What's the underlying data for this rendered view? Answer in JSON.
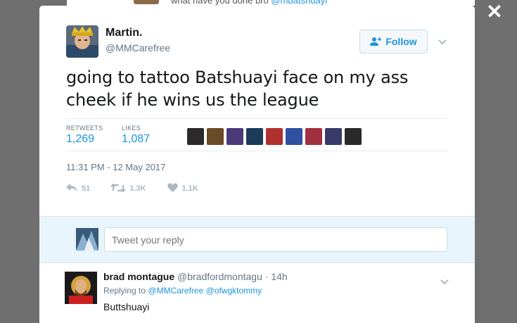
{
  "backdrop": {
    "text_prefix": "what have you done bro",
    "mention": "@mbatshuayi"
  },
  "close_label": "✕",
  "tweet": {
    "author_name": "Martin.",
    "author_handle": "@MMCarefree",
    "follow_label": "Follow",
    "text": "going to tattoo Batshuayi face on my ass cheek if he wins us the league",
    "retweets_label": "RETWEETS",
    "retweets_count": "1,269",
    "likes_label": "LIKES",
    "likes_count": "1,087",
    "timestamp": "11:31 PM - 12 May 2017",
    "actions": {
      "reply_count": "51",
      "retweet_count": "1.3K",
      "like_count": "1.1K"
    },
    "liker_colors": [
      "#2b2b2b",
      "#6b4a2a",
      "#4a3a7a",
      "#1e3a5a",
      "#b03030",
      "#3050a0",
      "#a03040",
      "#3a3a6a",
      "#2a2a2a"
    ]
  },
  "reply_box": {
    "placeholder": "Tweet your reply"
  },
  "reply_tweet": {
    "name": "brad montague",
    "handle": "@bradfordmontagu",
    "separator": "·",
    "time": "14h",
    "replying_to_prefix": "Replying to",
    "replying_to_1": "@MMCarefree",
    "replying_to_2": "@ofwgktommy",
    "text": "Buttshuayi"
  },
  "colors": {
    "accent": "#1b95e0",
    "muted": "#657786",
    "overlay": "#6f6f6f"
  }
}
